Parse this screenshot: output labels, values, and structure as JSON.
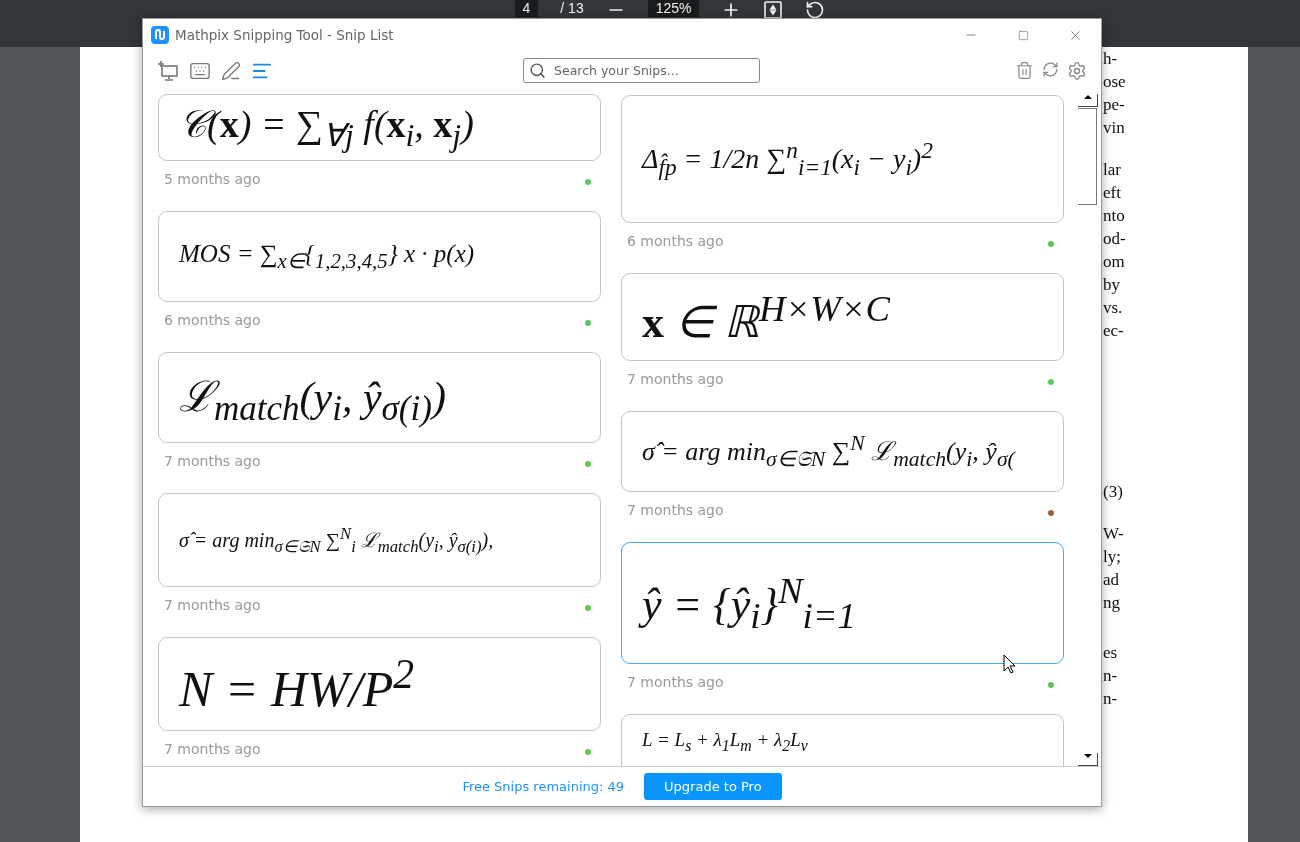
{
  "viewer": {
    "page": "4",
    "page_count": "/ 13",
    "zoom": "125%"
  },
  "page_text": [
    {
      "lines": [
        "h-",
        "ose",
        "pe-",
        "vin"
      ]
    },
    {
      "lines": [
        "lar",
        "eft",
        "nto",
        "od-",
        "om",
        "by",
        "vs.",
        "ec-"
      ]
    },
    {
      "lines": [
        "(3)"
      ]
    },
    {
      "lines": [
        "W-",
        "ly;",
        "ad",
        "ng"
      ]
    },
    {
      "lines": [
        "es",
        "n-",
        "n-"
      ]
    }
  ],
  "window": {
    "title": "Mathpix Snipping Tool - Snip List"
  },
  "toolbar": {
    "tools": [
      {
        "kind": "screenshot",
        "selected": false
      },
      {
        "kind": "keyboard",
        "selected": false
      },
      {
        "kind": "draw",
        "selected": false
      },
      {
        "kind": "list",
        "selected": true
      }
    ],
    "search": {
      "placeholder": "Search your Snips..."
    }
  },
  "columns": [
    [
      {
        "formula": "𝒞(**x**) = ∑$_{∀j}$ f(**x**$_{i}$, **x**$_{j}$)",
        "age": "5 months ago",
        "color": "#5ac85a",
        "selected": false
      },
      {
        "formula": "MOS = ∑$_{x∈}${$_{1,2,3,4,5}$} x · p(x)",
        "age": "6 months ago",
        "color": "#5ac85a",
        "selected": false
      },
      {
        "formula": "ℒ$_{match}$(y$_{i}$, ŷ$_{σ(i)}$)",
        "age": "7 months ago",
        "color": "#5ac85a",
        "selected": false
      },
      {
        "formula": "σ̂ = arg min$_{σ∈𝔖N}$ ∑$^{N}$$_{i}$ ℒ$_{match}$(y$_{i}$, ŷ$_{σ(i)}$),",
        "age": "7 months ago",
        "color": "#5ac85a",
        "selected": false
      },
      {
        "formula": "N = HW/P$^{2}$",
        "age": "7 months ago",
        "color": "#5ac85a",
        "selected": false
      }
    ],
    [
      {
        "formula": "Δ$_{f̂p}$ = 1/2n ∑$^{n}$$_{i=1}$(x$_{i}$ − y$_{i}$)$^{2}$",
        "age": "6 months ago",
        "color": "#5ac85a",
        "selected": false
      },
      {
        "formula": "**x** ∈ ℝ$^{H×W×C}$",
        "age": "7 months ago",
        "color": "#5ac85a",
        "selected": false
      },
      {
        "formula": "σ̂ = arg min$_{σ∈𝔖N}$ ∑$^{N}$ ℒ$_{match}$(y$_{i}$, ŷ$_{σ(}$",
        "age": "7 months ago",
        "color": "#a0613c",
        "selected": false
      },
      {
        "formula": "ŷ = {ŷ$_{i}$}$^{N}$$_{i=1}$",
        "age": "7 months ago",
        "color": "#5ac85a",
        "selected": true
      },
      {
        "formula": "L = L$_{s}$ + λ$_{1}$L$_{m}$ + λ$_{2}$L$_{v}$",
        "selected": false
      }
    ]
  ],
  "footer": {
    "remaining": "Free Snips remaining: 49",
    "upgrade": "Upgrade to Pro"
  }
}
